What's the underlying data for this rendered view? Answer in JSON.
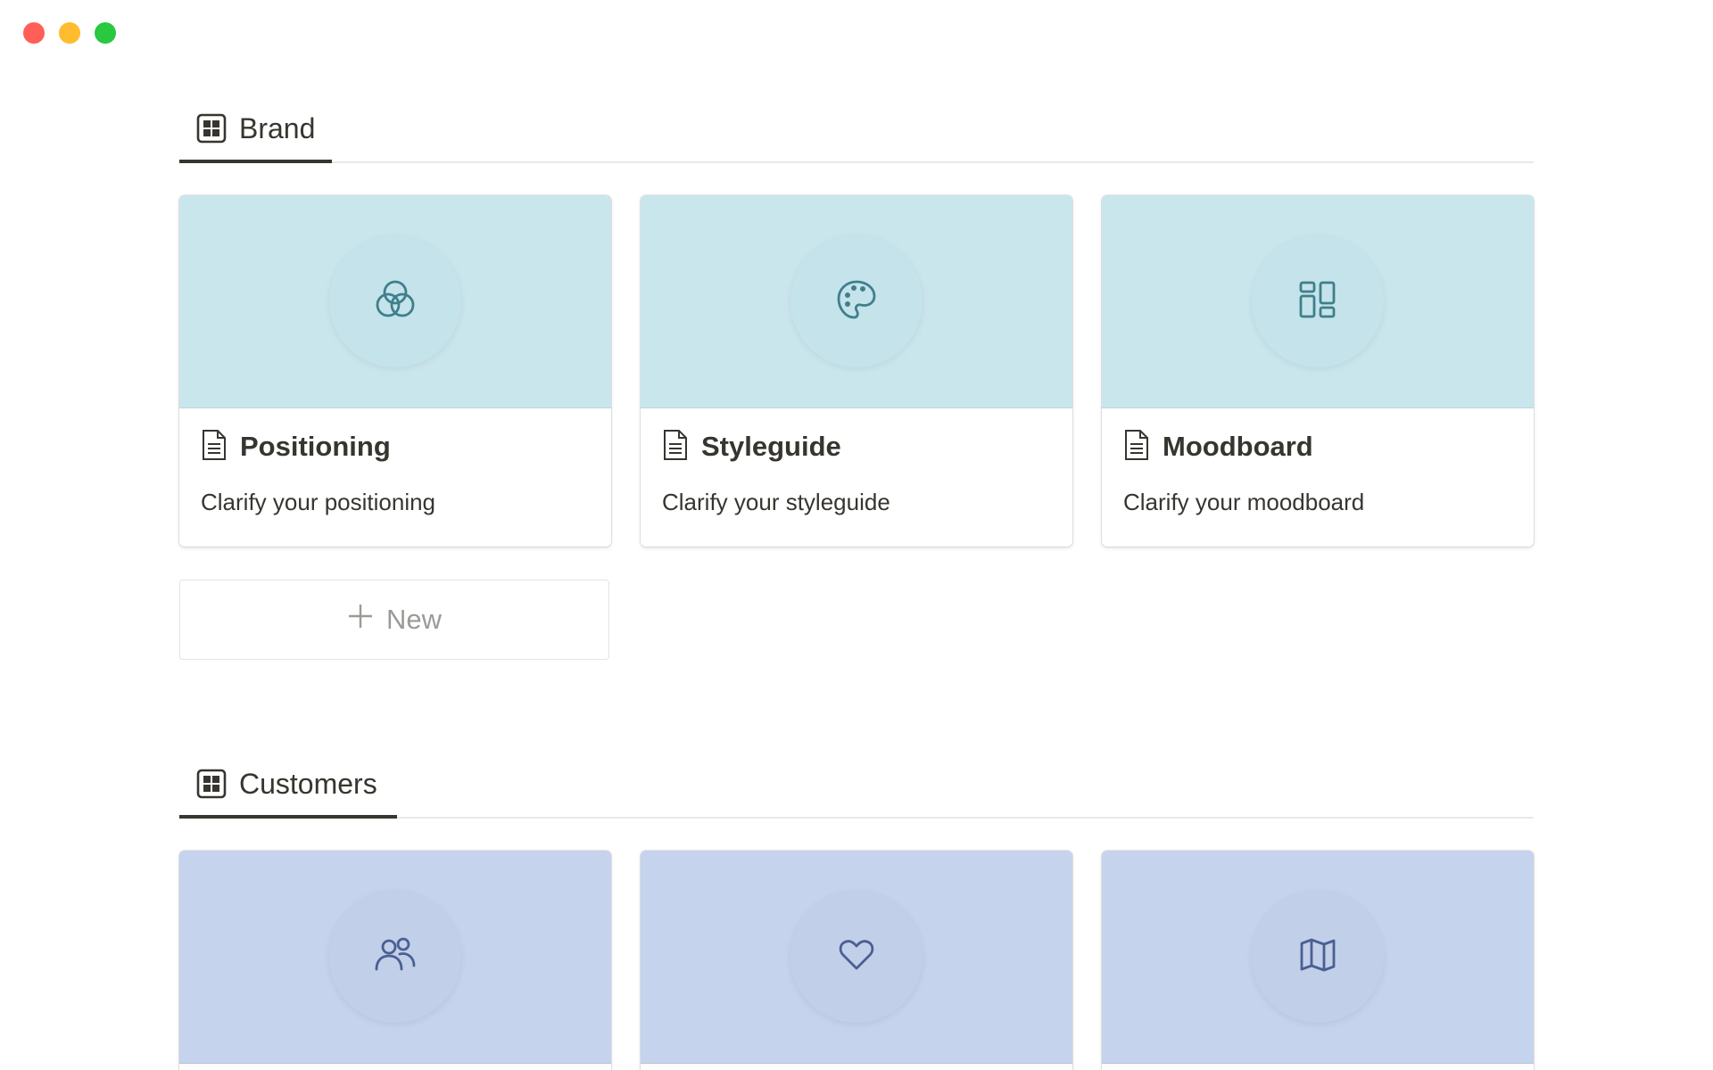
{
  "window": {
    "traffic_lights": {
      "close": "#ff5f57",
      "minimize": "#febc2e",
      "maximize": "#28c840"
    }
  },
  "sections": [
    {
      "tab_label": "Brand",
      "tab_icon": "table-grid-icon",
      "cover_color": "#cae6ed",
      "icon_color": "#3f7f8c",
      "cards": [
        {
          "title": "Positioning",
          "description": "Clarify your positioning",
          "icon": "venn-circles-icon"
        },
        {
          "title": "Styleguide",
          "description": "Clarify your styleguide",
          "icon": "palette-icon"
        },
        {
          "title": "Moodboard",
          "description": "Clarify your moodboard",
          "icon": "dashboard-layout-icon"
        }
      ],
      "new_label": "New"
    },
    {
      "tab_label": "Customers",
      "tab_icon": "table-grid-icon",
      "cover_color": "#c6d3ec",
      "icon_color": "#4a5f93",
      "cards": [
        {
          "icon": "people-icon"
        },
        {
          "icon": "heart-icon"
        },
        {
          "icon": "map-icon"
        }
      ]
    }
  ]
}
